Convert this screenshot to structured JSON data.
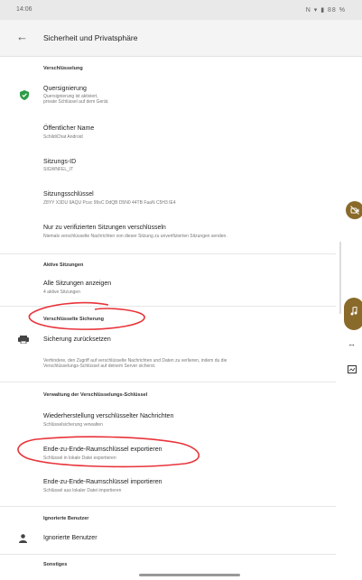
{
  "status": {
    "time": "14:06",
    "right": "N ▾ ▮ 88 %"
  },
  "appbar": {
    "back": "←",
    "title": "Sicherheit und Privatsphäre"
  },
  "sections": {
    "encryption": "Verschlüsselung",
    "sessions": "Aktive Sitzungen",
    "backup": "Verschlüsselte Sicherung",
    "key_management": "Verwaltung der Verschlüsselungs-Schlüssel",
    "ignored": "Ignorierte Benutzer",
    "other": "Sonstiges"
  },
  "items": {
    "cross_signing": {
      "title": "Quersignierung",
      "sub1": "Quersignierung ist aktiviert,",
      "sub2": "private Schlüssel auf dem Gerät."
    },
    "public_name": {
      "title": "Öffentlicher Name",
      "sub": "SchildiChat Android"
    },
    "session_id": {
      "title": "Sitzungs-ID",
      "sub": "SIGWNFEL_IT"
    },
    "session_key": {
      "title": "Sitzungsschlüssel",
      "sub": "Z8YY X3DU 9AQU Pcsc 99sC DdQB D5N0 44TB FaaN C5H3 IE4"
    },
    "verified_only": {
      "title": "Nur zu verifizierten Sitzungen verschlüsseln",
      "sub": "Niemals verschlüsselte Nachrichten von dieser Sitzung zu unverifizierten Sitzungen senden."
    },
    "all_sessions": {
      "title": "Alle Sitzungen anzeigen",
      "sub": "4 aktive Sitzungen"
    },
    "reset_backup": {
      "title": "Sicherung zurücksetzen"
    },
    "backup_info": {
      "line1": "Verhindere, den Zugriff auf verschlüsselte Nachrichten und Daten zu verlieren, indem du die",
      "line2": "Verschlüsselungs-Schlüssel auf deinem Server sicherst."
    },
    "restore": {
      "title": "Wiederherstellung verschlüsselter Nachrichten",
      "sub": "Schlüsselsicherung verwalten"
    },
    "export_keys": {
      "title": "Ende-zu-Ende-Raumschlüssel exportieren",
      "sub": "Schlüssel in lokale Datei exportieren"
    },
    "import_keys": {
      "title": "Ende-zu-Ende-Raumschlüssel importieren",
      "sub": "Schlüssel aus lokaler Datei importieren"
    },
    "ignored_users": {
      "title": "Ignorierte Benutzer"
    }
  },
  "icons": {
    "shield": "shield-icon",
    "backup": "backup-icon",
    "person": "person-icon",
    "fab_top": "no-video-icon",
    "fab_bottom": "music-note-icon",
    "side_arrows": "resize-icon",
    "side_screen": "screen-icon"
  },
  "colors": {
    "annotation": "#e8343a",
    "shield": "#2e9b46",
    "fab": "#8a6a2a"
  }
}
